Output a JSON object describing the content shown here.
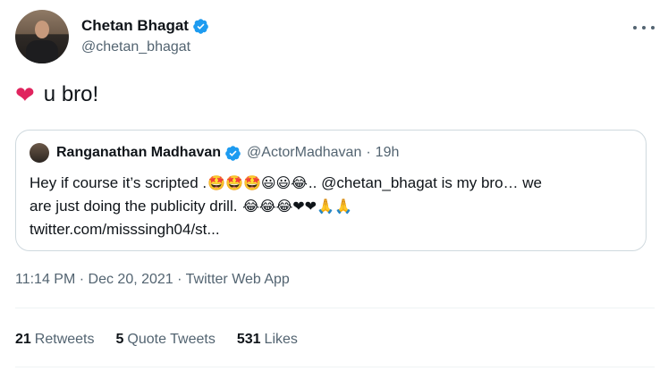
{
  "author": {
    "name": "Chetan Bhagat",
    "handle": "@chetan_bhagat"
  },
  "tweet": {
    "text": "u bro!",
    "heart_emoji": "❤"
  },
  "quote": {
    "name": "Ranganathan Madhavan",
    "handle": "@ActorMadhavan",
    "separator": "·",
    "time": "19h",
    "line1_pre": "Hey if course it’s scripted .",
    "line1_emojis": "🤩🤩🤩😃😃😂",
    "line1_post": ".. @chetan_bhagat  is my bro… we",
    "line2_pre": "are just doing the publicity drill. ",
    "line2_emojis": "😂😂😂❤❤🙏🙏",
    "line3": "twitter.com/misssingh04/st..."
  },
  "meta": {
    "text": "11:14 PM · Dec 20, 2021 · Twitter Web App"
  },
  "stats": {
    "retweets_count": "21",
    "retweets_label": "Retweets",
    "quotes_count": "5",
    "quotes_label": "Quote Tweets",
    "likes_count": "531",
    "likes_label": "Likes"
  },
  "colors": {
    "verified": "#1d9bf0",
    "heart": "#e0245e",
    "secondary_text": "#536471"
  }
}
